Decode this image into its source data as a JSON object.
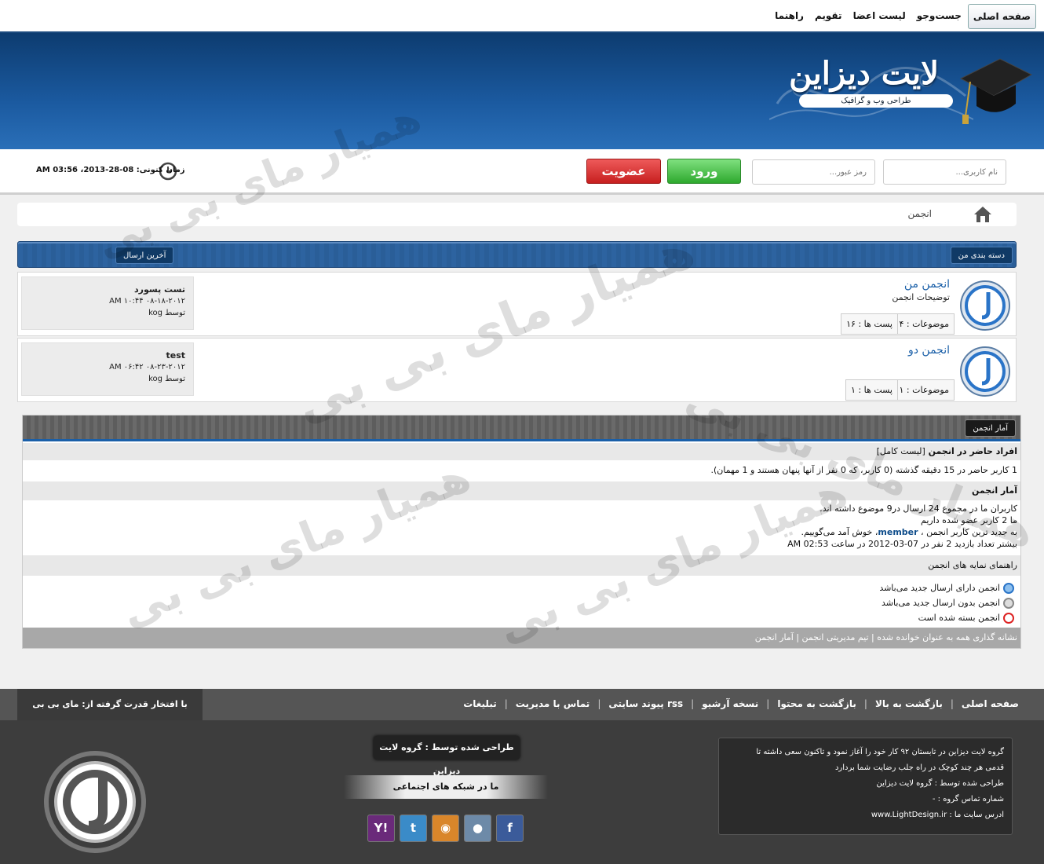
{
  "topnav": {
    "items": [
      "صفحه اصلی",
      "جست‌وجو",
      "لیست اعضا",
      "تقویم",
      "راهنما"
    ]
  },
  "header": {
    "title": "لایت دیزاین",
    "tagline": "طراحی وب و گرافیک"
  },
  "login": {
    "username_placeholder": "نام کاربری...",
    "password_placeholder": "رمز عبور...",
    "login_label": "ورود",
    "register_label": "عضویت",
    "time_label": "زمان کنونی:",
    "time_value": "08-28-2013، 03:56 AM"
  },
  "breadcrumb": {
    "current": "انجمن"
  },
  "category": {
    "name": "دسته بندی من",
    "last_post_header": "آخرین ارسال"
  },
  "forums": [
    {
      "name": "انجمن من",
      "description": "توضیحات انجمن",
      "topics": "موضوعات : ۴",
      "posts": "پست ها : ۱۶",
      "last_title": "تست پسورد",
      "last_date": "۰۸-۱۸-۲۰۱۲ ۱۰:۴۴ AM",
      "last_by": "توسط",
      "last_user": "kog"
    },
    {
      "name": "انجمن دو",
      "description": "",
      "topics": "موضوعات : ۱",
      "posts": "پست ها : ۱",
      "last_title": "test",
      "last_date": "۰۸-۲۳-۲۰۱۲ ۰۶:۴۲ AM",
      "last_by": "توسط",
      "last_user": "kog"
    }
  ],
  "stats": {
    "title": "آمار انجمن",
    "online_header": "افراد حاضر در انجمن",
    "online_full_list": "[لیست کامل]",
    "online_text": "1 کاربر حاضر در 15 دقیقه گذشته (0 کاربر، که 0 نفر از آنها پنهان هستند و 1 مهمان).",
    "board_header": "آمار انجمن",
    "board_line1": "کاربران ما در مجموع 24 ارسال در9 موضوع داشته اند.",
    "board_line2": "ما 2 کاربر عضو شده داریم",
    "board_line3_pre": "به جدید ترین کاربر انجمن ،",
    "board_line3_user": "member",
    "board_line3_post": "، خوش آمد می‌گوییم.",
    "board_line4": "بیشتر تعداد بازدید 2 نفر در 07-03-2012 در ساعت 02:53 AM",
    "legend_header": "راهنمای نمایه های انجمن",
    "legend_new": "انجمن دارای ارسال جدید می‌باشد",
    "legend_nonew": "انجمن بدون ارسال جدید می‌باشد",
    "legend_locked": "انجمن بسته شده است",
    "footer_links": "نشانه گذاری همه به عنوان خوانده شده | تیم مدیریتی انجمن | آمار انجمن"
  },
  "footer": {
    "nav": [
      "صفحه اصلی",
      "بازگشت به بالا",
      "بازگشت به محتوا",
      "نسخه آرشیو",
      "پیوند سایتی rss",
      "تماس با مدیریت",
      "تبلیغات"
    ],
    "powered_by": "با افتخار قدرت گرفته از: مای بی بی",
    "about_line1": "گروه لایت دیزاین در تابستان ۹۲ کار خود را آغاز نمود و تاکنون سعی داشته تا",
    "about_line2": "قدمی هر چند کوچک در راه جلب رضایت شما بردارد",
    "about_line3": "طراحی شده توسط : گروه لایت دیزاین",
    "about_line4": "شماره تماس گروه : -",
    "about_line5": "ادرس سایت ما : www.LightDesign.ir",
    "designed_by": "طراحی شده توسط : گروه لایت دیزاین",
    "social_title": "ما در شبکه های اجتماعی",
    "social_icons": [
      "yahoo-icon",
      "twitter-icon",
      "rss-icon",
      "chat-icon",
      "facebook-icon"
    ]
  },
  "watermark": "همیار مای بی بی",
  "colors": {
    "header_blue": "#1b5aa0",
    "login_green": "#2ea92e",
    "register_red": "#c71f1f",
    "link_blue": "#1a5fa8"
  }
}
